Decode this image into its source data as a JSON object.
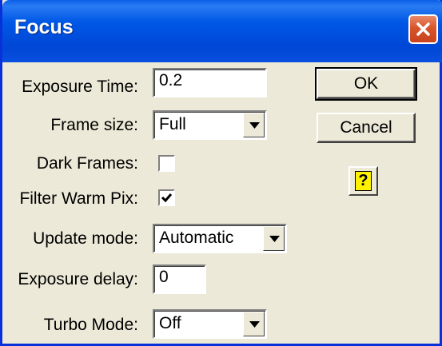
{
  "window": {
    "title": "Focus"
  },
  "fields": {
    "exposure_time": {
      "label": "Exposure Time:",
      "value": "0.2"
    },
    "frame_size": {
      "label": "Frame size:",
      "value": "Full"
    },
    "dark_frames": {
      "label": "Dark Frames:",
      "checked": false
    },
    "filter_warm_pix": {
      "label": "Filter Warm Pix:",
      "checked": true
    },
    "update_mode": {
      "label": "Update mode:",
      "value": "Automatic"
    },
    "exposure_delay": {
      "label": "Exposure delay:",
      "value": "0"
    },
    "turbo_mode": {
      "label": "Turbo Mode:",
      "value": "Off"
    }
  },
  "buttons": {
    "ok": "OK",
    "cancel": "Cancel",
    "help": "?"
  },
  "icons": {
    "close": "close-icon",
    "dropdown": "chevron-down-icon",
    "check": "check-icon",
    "help": "help-icon"
  },
  "colors": {
    "titlebar": "#0054e3",
    "close": "#d8552c",
    "dialog_bg": "#ece9d8",
    "help_yellow": "#fff200"
  }
}
